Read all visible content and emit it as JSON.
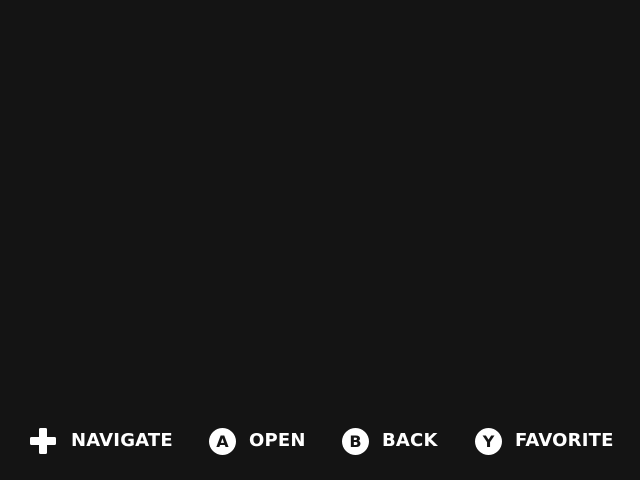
{
  "button_hints": [
    {
      "icon": "dpad-icon",
      "button": "",
      "label": "NAVIGATE"
    },
    {
      "icon": "a-button-icon",
      "button": "A",
      "label": "OPEN"
    },
    {
      "icon": "b-button-icon",
      "button": "B",
      "label": "BACK"
    },
    {
      "icon": "y-button-icon",
      "button": "Y",
      "label": "FAVORITE"
    }
  ],
  "colors": {
    "background": "#141414",
    "foreground": "#ffffff"
  }
}
